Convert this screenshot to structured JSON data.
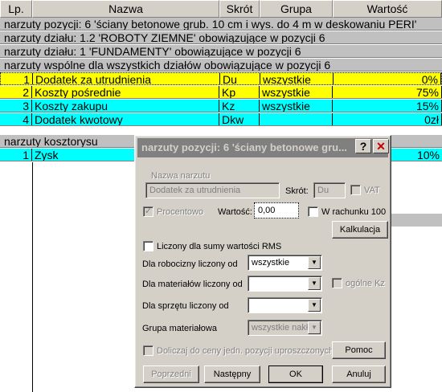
{
  "columns": {
    "lp": "Lp.",
    "nazwa": "Nazwa",
    "skrot": "Skrót",
    "grupa": "Grupa",
    "wartosc": "Wartość"
  },
  "groups": {
    "pozycja": "narzuty pozycji: 6 'ściany betonowe grub. 10 cm i wys. do 4 m w deskowaniu PERI'",
    "dzial12": "narzuty działu: 1.2 'ROBOTY ZIEMNE' obowiązujące w pozycji 6",
    "dzial1": "narzuty działu: 1 'FUNDAMENTY' obowiązujące w pozycji 6",
    "wspolne": "narzuty wspólne dla wszystkich działów obowiązujące w pozycji 6",
    "kosztorys": "narzuty kosztorysu"
  },
  "rows": [
    {
      "lp": "1",
      "nazwa": "Dodatek za utrudnienia",
      "skrot": "Du",
      "grupa": "wszystkie",
      "wartosc": "0%"
    },
    {
      "lp": "2",
      "nazwa": "Koszty pośrednie",
      "skrot": "Kp",
      "grupa": "wszystkie",
      "wartosc": "75%"
    },
    {
      "lp": "3",
      "nazwa": "Koszty zakupu",
      "skrot": "Kz",
      "grupa": "wszystkie",
      "wartosc": "15%"
    },
    {
      "lp": "4",
      "nazwa": "Dodatek kwotowy",
      "skrot": "Dkw",
      "grupa": "",
      "wartosc": "0zł"
    }
  ],
  "kosztorys_row": {
    "lp": "1",
    "nazwa": "Zysk",
    "wartosc": "10%"
  },
  "colors": {
    "yellow": "#ffff00",
    "cyan": "#00ffff",
    "gray": "#c0c0c0",
    "dialog": "#d4d0c8"
  },
  "dialog": {
    "title": "narzuty pozycji: 6 'ściany betonowe gru...",
    "help_label": "?",
    "close_label": "✕",
    "nazwa_label": "Nazwa narzutu",
    "nazwa_value": "Dodatek za utrudnienia",
    "skrot_label": "Skrót:",
    "skrot_value": "Du",
    "vat_label": "VAT",
    "procentowo_label": "Procentowo",
    "wartosc_label": "Wartość:",
    "wartosc_value": "0,00",
    "w_rachunku_label": "W rachunku 100",
    "kalkulacja_label": "Kalkulacja",
    "liczony_rms_label": "Liczony dla sumy wartości RMS",
    "robocizna_label": "Dla robocizny liczony od",
    "robocizna_value": "wszystkie",
    "materialy_label": "Dla materiałów liczony od",
    "materialy_value": "",
    "ogolne_kz_label": "ogólne Kz",
    "sprzet_label": "Dla sprzętu liczony od",
    "sprzet_value": "",
    "grupa_mat_label": "Grupa materiałowa",
    "grupa_mat_value": "wszystkie nakł",
    "doliczaj_label": "Doliczaj do ceny jedn. pozycji uproszczonych",
    "pomoc_label": "Pomoc",
    "poprzedni_label": "Poprzedni",
    "nastepny_label": "Następny",
    "ok_label": "OK",
    "anuluj_label": "Anuluj"
  }
}
